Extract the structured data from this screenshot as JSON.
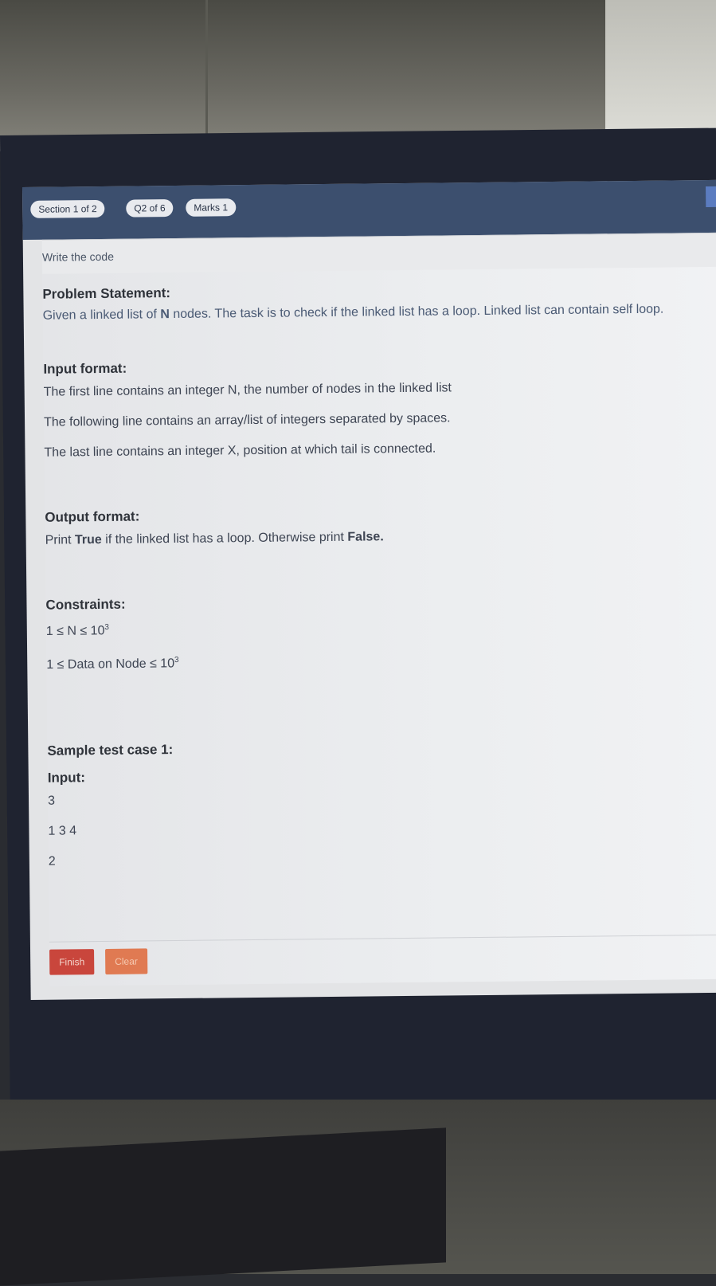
{
  "header": {
    "section": "Section 1 of 2",
    "question": "Q2 of 6",
    "marks": "Marks 1"
  },
  "question_type": "Write the code",
  "problem": {
    "statement_heading": "Problem Statement:",
    "statement_text_1": "Given a linked list of ",
    "statement_bold_n": "N",
    "statement_text_2": " nodes. The task is to check if the linked list has a loop. Linked list can contain self loop.",
    "input_heading": "Input format:",
    "input_lines": [
      "The first line contains an integer N, the number of nodes in the linked list",
      "The following line contains an array/list of integers separated by spaces.",
      "The last line contains an integer X, position at which tail is connected."
    ],
    "output_heading": "Output format:",
    "output_text_1": "Print ",
    "output_bold_true": "True",
    "output_text_2": " if the linked list has a loop. Otherwise print ",
    "output_bold_false": "False.",
    "constraints_heading": "Constraints:",
    "constraint_1_text": "1 ≤ N ≤ 10",
    "constraint_1_exp": "3",
    "constraint_2_text": "1 ≤ Data on Node ≤ 10",
    "constraint_2_exp": "3",
    "sample_heading": "Sample test case 1:",
    "sample_input_heading": "Input:",
    "sample_input_lines": [
      "3",
      "1 3 4",
      "2"
    ]
  },
  "buttons": {
    "finish": "Finish",
    "clear": "Clear"
  }
}
